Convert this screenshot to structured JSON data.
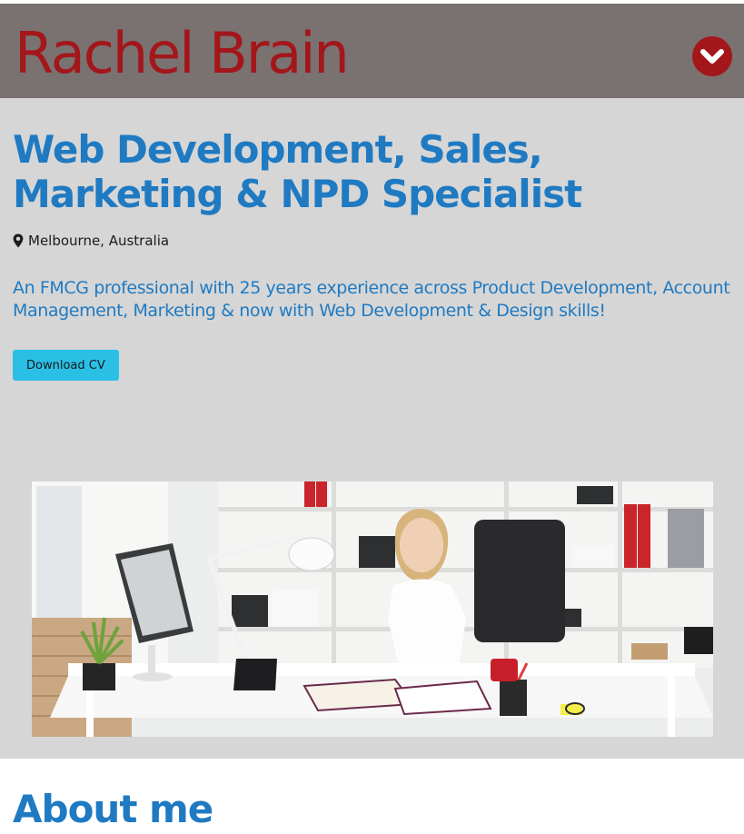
{
  "header": {
    "site_title": "Rachel Brain",
    "menu_icon": "chevron-down-circle-icon"
  },
  "hero": {
    "title": "Web Development, Sales, Marketing & NPD Specialist",
    "location_icon": "map-marker-icon",
    "location": "Melbourne, Australia",
    "summary": "An FMCG professional with 25 years experience across Product Development, Account Management, Marketing & now with Web Development & Design skills!",
    "download_label": "Download CV",
    "image": "photo of woman seated at a white office desk"
  },
  "about": {
    "heading": "About me"
  },
  "colors": {
    "header_bg": "#7a7171",
    "brand_red": "#a3161a",
    "hero_bg": "#d6d6d6",
    "heading_blue": "#1f7ac2",
    "button_cyan": "#2ac0e6"
  }
}
